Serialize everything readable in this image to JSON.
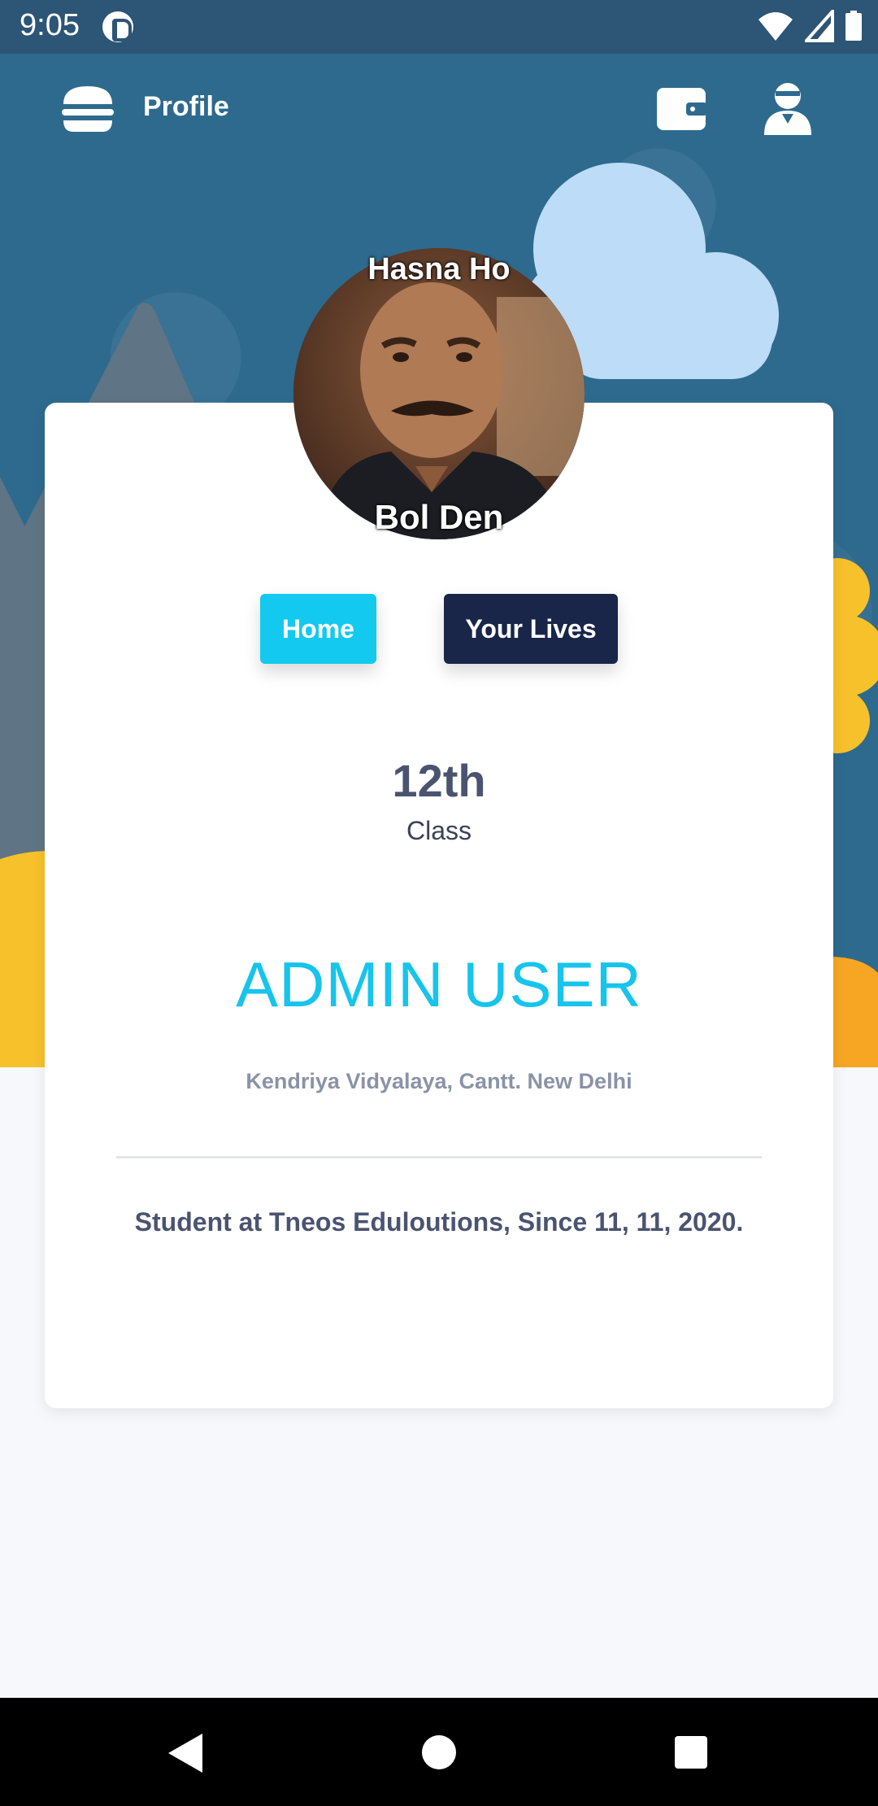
{
  "status_bar": {
    "time": "9:05",
    "icons": [
      "app-notification-icon",
      "wifi-icon",
      "cell-signal-icon",
      "battery-icon"
    ]
  },
  "app_bar": {
    "title": "Profile",
    "icons": [
      "hamburger-menu-icon",
      "wallet-icon",
      "user-profile-icon"
    ]
  },
  "profile": {
    "avatar_caption_top": "Hasna Ho",
    "avatar_caption_bottom": "Bol Den",
    "buttons": {
      "home": "Home",
      "lives": "Your Lives"
    },
    "class_value": "12th",
    "class_label": "Class",
    "name": "ADMIN USER",
    "school": "Kendriya Vidyalaya, Cantt. New Delhi",
    "since": "Student at Tneos Eduloutions, Since 11, 11, 2020."
  },
  "colors": {
    "header_blue": "#2e6a8e",
    "accent_cyan": "#13c9f0",
    "navy": "#19264a",
    "sun_yellow": "#f7c12c"
  },
  "nav_bar": {
    "icons": [
      "back-icon",
      "home-circle-icon",
      "recents-square-icon"
    ]
  }
}
